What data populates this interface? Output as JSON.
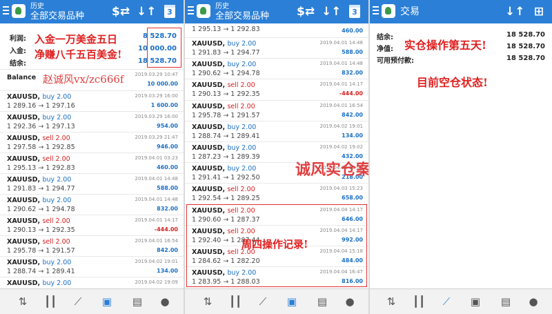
{
  "panel1": {
    "header_title": "历史",
    "header_subtitle": "全部交易品种",
    "calendar_day": "3",
    "summary": [
      {
        "label": "利润:",
        "value": "8 528.70"
      },
      {
        "label": "入金:",
        "value": "10 000.00"
      },
      {
        "label": "结余:",
        "value": "18 528.70"
      }
    ],
    "note_line1": "入金一万美金五日",
    "note_line2": "净赚八千五百美金!",
    "watermark": "赵诚风vx/zc666f",
    "balance": {
      "label": "Balance",
      "date": "2019.03.29 10:47",
      "value": "10 000.00"
    },
    "trades": [
      {
        "symbol": "XAUUSD,",
        "side": "buy 2.00",
        "type": "buy",
        "prices": "1 289.16 → 1 297.16",
        "date": "2019.03.29 16:00",
        "profit": "1 600.00"
      },
      {
        "symbol": "XAUUSD,",
        "side": "buy 2.00",
        "type": "buy",
        "prices": "1 292.36 → 1 297.13",
        "date": "2019.03.29 16:00",
        "profit": "954.00"
      },
      {
        "symbol": "XAUUSD,",
        "side": "sell 2.00",
        "type": "sell",
        "prices": "1 297.58 → 1 292.85",
        "date": "2019.03.29 21:47",
        "profit": "946.00"
      },
      {
        "symbol": "XAUUSD,",
        "side": "sell 2.00",
        "type": "sell",
        "prices": "1 295.13 → 1 292.83",
        "date": "2019.04.01 03:23",
        "profit": "460.00"
      },
      {
        "symbol": "XAUUSD,",
        "side": "buy 2.00",
        "type": "buy",
        "prices": "1 291.83 → 1 294.77",
        "date": "2019.04.01 14:48",
        "profit": "588.00"
      },
      {
        "symbol": "XAUUSD,",
        "side": "buy 2.00",
        "type": "buy",
        "prices": "1 290.62 → 1 294.78",
        "date": "2019.04.01 14:48",
        "profit": "832.00"
      },
      {
        "symbol": "XAUUSD,",
        "side": "sell 2.00",
        "type": "sell",
        "prices": "1 290.13 → 1 292.35",
        "date": "2019.04.01 14:17",
        "profit": "-444.00",
        "neg": true
      },
      {
        "symbol": "XAUUSD,",
        "side": "sell 2.00",
        "type": "sell",
        "prices": "1 295.78 → 1 291.57",
        "date": "2019.04.01 16:54",
        "profit": "842.00"
      },
      {
        "symbol": "XAUUSD,",
        "side": "buy 2.00",
        "type": "buy",
        "prices": "1 288.74 → 1 289.41",
        "date": "2019.04.02 19:01",
        "profit": "134.00"
      },
      {
        "symbol": "XAUUSD,",
        "side": "buy 2.00",
        "type": "buy",
        "prices": "",
        "date": "2019.04.02 19:09",
        "profit": ""
      }
    ]
  },
  "panel2": {
    "header_title": "历史",
    "header_subtitle": "全部交易品种",
    "calendar_day": "3",
    "top_partial": {
      "prices": "1 295.13 → 1 292.83",
      "profit": "460.00"
    },
    "trades": [
      {
        "symbol": "XAUUSD,",
        "side": "buy 2.00",
        "type": "buy",
        "prices": "1 291.83 → 1 294.77",
        "date": "2019.04.01 14:48",
        "profit": "588.00"
      },
      {
        "symbol": "XAUUSD,",
        "side": "buy 2.00",
        "type": "buy",
        "prices": "1 290.62 → 1 294.78",
        "date": "2019.04.01 14:48",
        "profit": "832.00"
      },
      {
        "symbol": "XAUUSD,",
        "side": "sell 2.00",
        "type": "sell",
        "prices": "1 290.13 → 1 292.35",
        "date": "2019.04.01 14:17",
        "profit": "-444.00",
        "neg": true
      },
      {
        "symbol": "XAUUSD,",
        "side": "sell 2.00",
        "type": "sell",
        "prices": "1 295.78 → 1 291.57",
        "date": "2019.04.01 16:54",
        "profit": "842.00"
      },
      {
        "symbol": "XAUUSD,",
        "side": "buy 2.00",
        "type": "buy",
        "prices": "1 288.74 → 1 289.41",
        "date": "2019.04.02 19:01",
        "profit": "134.00"
      },
      {
        "symbol": "XAUUSD,",
        "side": "buy 2.00",
        "type": "buy",
        "prices": "1 287.23 → 1 289.39",
        "date": "2019.04.02 19:02",
        "profit": "432.00"
      },
      {
        "symbol": "XAUUSD,",
        "side": "buy 2.00",
        "type": "buy",
        "prices": "1 291.41 → 1 292.50",
        "date": "2019.04.02 19:09",
        "profit": "218.00"
      },
      {
        "symbol": "XAUUSD,",
        "side": "sell 2.00",
        "type": "sell",
        "prices": "1 292.54 → 1 289.25",
        "date": "2019.04.03 15:23",
        "profit": "658.00"
      },
      {
        "symbol": "XAUUSD,",
        "side": "sell 2.00",
        "type": "sell",
        "prices": "1 290.60 → 1 287.37",
        "date": "2019.04.04 14:17",
        "profit": "646.00"
      },
      {
        "symbol": "XAUUSD,",
        "side": "sell 2.00",
        "type": "sell",
        "prices": "1 292.40 → 1 287.44",
        "date": "2019.04.04 14:17",
        "profit": "992.00"
      },
      {
        "symbol": "XAUUSD,",
        "side": "sell 2.00",
        "type": "sell",
        "prices": "1 284.62 → 1 282.20",
        "date": "2019.04.04 15:18",
        "profit": "484.00"
      },
      {
        "symbol": "XAUUSD,",
        "side": "buy 2.00",
        "type": "buy",
        "prices": "1 283.95 → 1 288.03",
        "date": "2019.04.04 16:47",
        "profit": "816.00"
      }
    ],
    "note_thursday": "周四操作记录!",
    "watermark_case": "诚风实仓案例!"
  },
  "panel3": {
    "header_title": "交易",
    "summary": [
      {
        "label": "结余:",
        "value": "18 528.70"
      },
      {
        "label": "净值:",
        "value": "18 528.70"
      },
      {
        "label": "可用预付款:",
        "value": "18 528.70"
      }
    ],
    "note_day5": "实仓操作第五天!",
    "note_empty": "目前空仓状态!"
  },
  "icons": {
    "menu": "menu-icon",
    "currency_exchange": "$⇄",
    "sort": "↓↑",
    "add_order": "+"
  },
  "colors": {
    "header": "#2b7fd6",
    "buy": "#1a6fc4",
    "sell": "#d42020",
    "annotation": "#e02020"
  }
}
